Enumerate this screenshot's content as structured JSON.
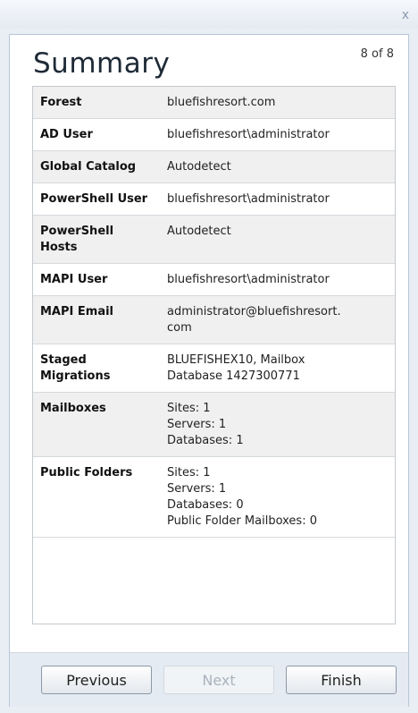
{
  "window": {
    "close_label": "x"
  },
  "header": {
    "title": "Summary",
    "page_counter": "8 of 8"
  },
  "summary_rows": [
    {
      "key": "Forest",
      "value": [
        "bluefishresort.com"
      ]
    },
    {
      "key": "AD User",
      "value": [
        "bluefishresort\\administrator"
      ]
    },
    {
      "key": "Global Catalog",
      "value": [
        "Autodetect"
      ]
    },
    {
      "key": "PowerShell User",
      "value": [
        "bluefishresort\\administrator"
      ]
    },
    {
      "key": "PowerShell Hosts",
      "value": [
        "Autodetect"
      ]
    },
    {
      "key": "MAPI User",
      "value": [
        "bluefishresort\\administrator"
      ]
    },
    {
      "key": "MAPI Email",
      "value": [
        "administrator@bluefishresort.",
        "com"
      ]
    },
    {
      "key": "Staged Migrations",
      "value": [
        "BLUEFISHEX10, Mailbox",
        "Database 1427300771"
      ]
    },
    {
      "key": "Mailboxes",
      "value": [
        "Sites: 1",
        "Servers: 1",
        "Databases: 1"
      ]
    },
    {
      "key": "Public Folders",
      "value": [
        "Sites: 1",
        "Servers: 1",
        "Databases: 0",
        "Public Folder Mailboxes: 0"
      ]
    }
  ],
  "buttons": {
    "previous": "Previous",
    "next": "Next",
    "finish": "Finish"
  }
}
